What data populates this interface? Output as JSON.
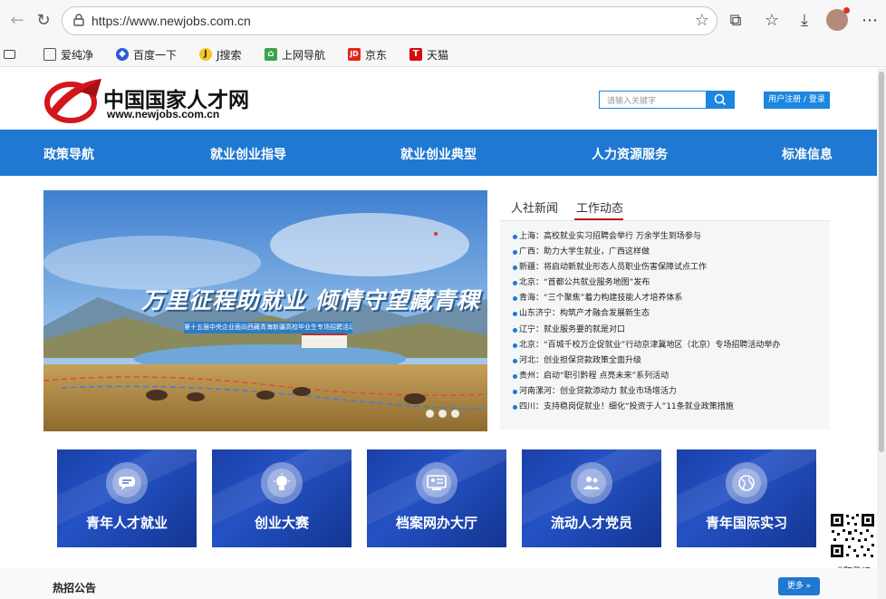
{
  "browser": {
    "url": "https://www.newjobs.com.cn",
    "bookmarks": [
      "爱纯净",
      "百度一下",
      "J搜索",
      "上网导航",
      "京东",
      "天猫"
    ]
  },
  "site": {
    "logo_name": "中国国家人才网",
    "logo_domain": "www.newjobs.com.cn",
    "search_placeholder": "请输入关键字",
    "register_label": "用户注册 / 登录"
  },
  "nav": [
    "政策导航",
    "就业创业指导",
    "就业创业典型",
    "人力资源服务",
    "标准信息"
  ],
  "banner": {
    "headline": "万里征程助就业 倾情守望藏青稞",
    "subtitle": "第十五届中央企业面向西藏青海新疆高校毕业生专场招聘活动"
  },
  "news": {
    "tabs": [
      "人社新闻",
      "工作动态"
    ],
    "active_tab": "工作动态",
    "items": [
      "上海：高校就业实习招聘会举行 万余学生到场参与",
      "广西：助力大学生就业，广西这样做",
      "新疆：将启动新就业形态人员职业伤害保障试点工作",
      "北京：“首都公共就业服务地图”发布",
      "青海：“三个聚焦”着力构建技能人才培养体系",
      "山东济宁：构筑产才融合发展新生态",
      "辽宁：就业服务要的就是对口",
      "北京：“百城千校万企促就业”行动京津冀地区（北京）专场招聘活动举办",
      "河北：创业担保贷款政策全面升级",
      "贵州：启动“职引黔程 点亮未来”系列活动",
      "河南漯河：创业贷款添动力 就业市场增活力",
      "四川：支持稳岗促就业！细化“投资于人”11条就业政策措施"
    ]
  },
  "cards": [
    "青年人才就业",
    "创业大赛",
    "档案网办大厅",
    "流动人才党员",
    "青年国际实习"
  ],
  "qrcode": {
    "caption": "求职登记"
  },
  "lower": {
    "title": "热招公告",
    "more_label": "更多 »"
  },
  "colors": {
    "primary_blue": "#1f78d1",
    "card_blue": "#2452c4",
    "accent_red": "#c31b1b"
  }
}
